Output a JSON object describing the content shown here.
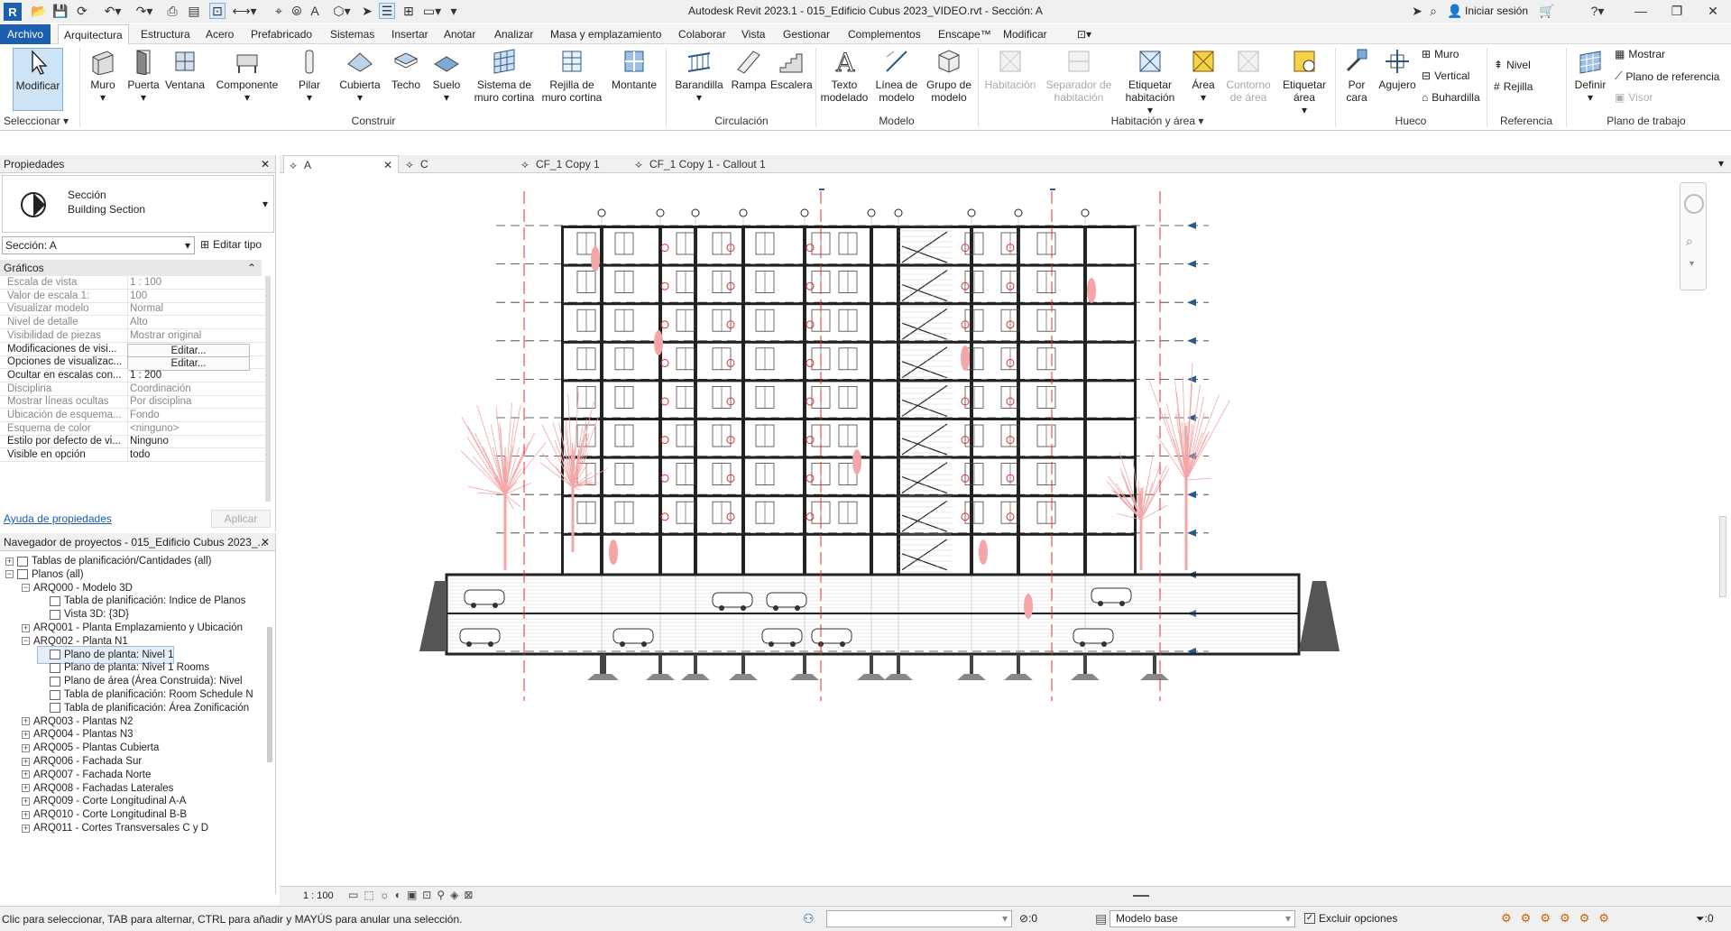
{
  "titlebar": {
    "title": "Autodesk Revit 2023.1 - 015_Edificio Cubus 2023_VIDEO.rvt - Sección: A",
    "signin": "Iniciar sesión",
    "icons": [
      "revit-logo-icon",
      "open-icon",
      "save-icon",
      "sync-icon",
      "undo-icon",
      "redo-icon",
      "print-icon",
      "measure-icon",
      "dimension-icon",
      "tag-icon",
      "text-icon",
      "3d-view-icon",
      "section-icon",
      "thin-lines-icon",
      "close-hidden-icon",
      "switch-windows-icon"
    ]
  },
  "ribbon_tabs": [
    "Archivo",
    "Arquitectura",
    "Estructura",
    "Acero",
    "Prefabricado",
    "Sistemas",
    "Insertar",
    "Anotar",
    "Analizar",
    "Masa y emplazamiento",
    "Colaborar",
    "Vista",
    "Gestionar",
    "Complementos",
    "Enscape™",
    "Modificar"
  ],
  "ribbon": {
    "select": {
      "modify": "Modificar",
      "group": "Seleccionar"
    },
    "build": {
      "items": [
        "Muro",
        "Puerta",
        "Ventana",
        "Componente",
        "Pilar",
        "Cubierta",
        "Techo",
        "Suelo",
        "Sistema de muro cortina",
        "Rejilla de muro cortina",
        "Montante"
      ],
      "group": "Construir"
    },
    "circulation": {
      "items": [
        "Barandilla",
        "Rampa",
        "Escalera"
      ],
      "group": "Circulación"
    },
    "model": {
      "items": [
        "Texto modelado",
        "Línea de modelo",
        "Grupo de modelo"
      ],
      "group": "Modelo"
    },
    "room": {
      "items": [
        "Habitación",
        "Separador de habitación",
        "Etiquetar habitación",
        "Área",
        "Contorno de área",
        "Etiquetar área"
      ],
      "group": "Habitación y área"
    },
    "opening": {
      "items": [
        "Por cara",
        "Agujero"
      ],
      "small": [
        "Muro",
        "Vertical",
        "Buhardilla"
      ],
      "group": "Hueco"
    },
    "datum": {
      "small": [
        "Nivel",
        "Rejilla"
      ],
      "group": "Referencia"
    },
    "workplane": {
      "define": "Definir",
      "small": [
        "Mostrar",
        "Plano de referencia",
        "Visor"
      ],
      "group": "Plano de trabajo"
    }
  },
  "properties": {
    "panel_title": "Propiedades",
    "type_line1": "Sección",
    "type_line2": "Building Section",
    "instance": "Sección: A",
    "edit_type": "Editar tipo",
    "category": "Gráficos",
    "rows": [
      {
        "k": "Escala de vista",
        "v": "1 : 100",
        "dim": true
      },
      {
        "k": "Valor de escala    1:",
        "v": "100",
        "dim": true
      },
      {
        "k": "Visualizar modelo",
        "v": "Normal",
        "dim": true
      },
      {
        "k": "Nivel de detalle",
        "v": "Alto",
        "dim": true
      },
      {
        "k": "Visibilidad de piezas",
        "v": "Mostrar original",
        "dim": true
      },
      {
        "k": "Modificaciones de visi...",
        "v": "Editar...",
        "btn": true
      },
      {
        "k": "Opciones de visualizac...",
        "v": "Editar...",
        "btn": true
      },
      {
        "k": "Ocultar en escalas con...",
        "v": "1 : 200"
      },
      {
        "k": "Disciplina",
        "v": "Coordinación",
        "dim": true
      },
      {
        "k": "Mostrar líneas ocultas",
        "v": "Por disciplina",
        "dim": true
      },
      {
        "k": "Ubicación de esquema...",
        "v": "Fondo",
        "dim": true
      },
      {
        "k": "Esquema de color",
        "v": "<ninguno>",
        "dim": true
      },
      {
        "k": "Estilo por defecto de vi...",
        "v": "Ninguno"
      },
      {
        "k": "Visible en opción",
        "v": "todo"
      }
    ],
    "help": "Ayuda de propiedades",
    "apply": "Aplicar"
  },
  "browser": {
    "title": "Navegador de proyectos - 015_Edificio Cubus 2023_...",
    "items": [
      {
        "t": "Tablas de planificación/Cantidades (all)",
        "l": 0,
        "pm": "+",
        "ic": true
      },
      {
        "t": "Planos (all)",
        "l": 0,
        "pm": "−",
        "ic": true
      },
      {
        "t": "ARQ000 - Modelo 3D",
        "l": 1,
        "pm": "−"
      },
      {
        "t": "Tabla de planificación: Indice de Planos",
        "l": 2,
        "ic": true
      },
      {
        "t": "Vista 3D: {3D}",
        "l": 2,
        "ic": true
      },
      {
        "t": "ARQ001 - Planta Emplazamiento y Ubicación",
        "l": 1,
        "pm": "+"
      },
      {
        "t": "ARQ002 - Planta N1",
        "l": 1,
        "pm": "−"
      },
      {
        "t": "Plano de planta: Nivel 1",
        "l": 2,
        "ic": true,
        "sel": true
      },
      {
        "t": "Plano de planta: Nivel 1 Rooms",
        "l": 2,
        "ic": true
      },
      {
        "t": "Plano de área (Área Construida): Nivel",
        "l": 2,
        "ic": true
      },
      {
        "t": "Tabla de planificación: Room Schedule N",
        "l": 2,
        "ic": true
      },
      {
        "t": "Tabla de planificación: Área Zonificación",
        "l": 2,
        "ic": true
      },
      {
        "t": "ARQ003 - Plantas N2",
        "l": 1,
        "pm": "+"
      },
      {
        "t": "ARQ004 - Plantas N3",
        "l": 1,
        "pm": "+"
      },
      {
        "t": "ARQ005 - Plantas Cubierta",
        "l": 1,
        "pm": "+"
      },
      {
        "t": "ARQ006 - Fachada Sur",
        "l": 1,
        "pm": "+"
      },
      {
        "t": "ARQ007 - Fachada Norte",
        "l": 1,
        "pm": "+"
      },
      {
        "t": "ARQ008 - Fachadas Laterales",
        "l": 1,
        "pm": "+"
      },
      {
        "t": "ARQ009 - Corte Longitudinal A-A",
        "l": 1,
        "pm": "+"
      },
      {
        "t": "ARQ010 - Corte Longitudinal B-B",
        "l": 1,
        "pm": "+"
      },
      {
        "t": "ARQ011 - Cortes Transversales C y D",
        "l": 1,
        "pm": "+"
      }
    ]
  },
  "view_tabs": [
    "A",
    "C",
    "CF_1 Copy 1",
    "CF_1 Copy 1 - Callout 1"
  ],
  "view_bar": {
    "scale": "1 : 100"
  },
  "status": {
    "message": "Clic para seleccionar, TAB para alternar, CTRL para añadir y MAYÚS para anular una selección.",
    "sel_count": ":0",
    "model": "Modelo base",
    "exclude": "Excluir opciones",
    "filter_count": ":0"
  },
  "colors": {
    "accent": "#1b5fae",
    "tree": "#f4a6a6",
    "section_line": "#e03030",
    "draw": "#222222"
  }
}
